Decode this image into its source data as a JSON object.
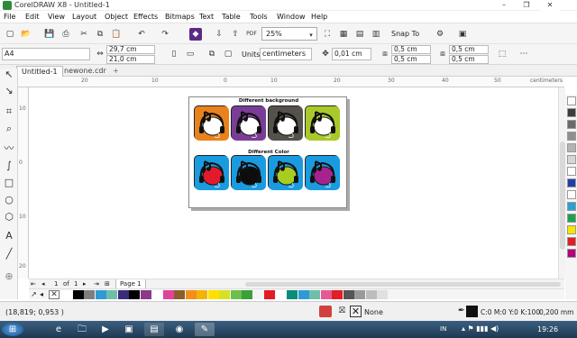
{
  "window": {
    "title": "CorelDRAW X8 - Untitled-1",
    "min": "–",
    "max": "❐",
    "close": "✕"
  },
  "menu": [
    "File",
    "Edit",
    "View",
    "Layout",
    "Object",
    "Effects",
    "Bitmaps",
    "Text",
    "Table",
    "Tools",
    "Window",
    "Help"
  ],
  "toolbar": {
    "zoom": "25%",
    "snap_to": "Snap To",
    "pdf_label": "PDF"
  },
  "properties": {
    "paper_size": "A4",
    "width": "29,7 cm",
    "height": "21,0 cm",
    "units_label": "Units:",
    "units": "centimeters",
    "nudge": "0,01 cm",
    "dup_x": "0,5 cm",
    "dup_y": "0,5 cm",
    "dup_x2": "0,5 cm",
    "dup_y2": "0,5 cm"
  },
  "tabs": {
    "active": "Untitled-1",
    "other": "newone.cdr",
    "add": "+"
  },
  "rulers": {
    "unit": "centimeters",
    "h_ticks": [
      "20",
      "10",
      "0",
      "10",
      "20",
      "30",
      "40",
      "50"
    ],
    "v_ticks": [
      "10",
      "0",
      "10",
      "20"
    ]
  },
  "page": {
    "section1": "Different background",
    "section2": "Different Color",
    "top_tiles": [
      {
        "bg": "#e8821c",
        "icon": "#ffffff"
      },
      {
        "bg": "#7a3d96",
        "icon": "#ffffff"
      },
      {
        "bg": "#55524b",
        "icon": "#ffffff"
      },
      {
        "bg": "#a9c92a",
        "icon": "#ffffff"
      }
    ],
    "bottom_tiles": [
      {
        "bg": "#1a9be0",
        "icon": "#e21b2c"
      },
      {
        "bg": "#1a9be0",
        "icon": "#0d0d0d"
      },
      {
        "bg": "#1a9be0",
        "icon": "#a8cd20"
      },
      {
        "bg": "#1a9be0",
        "icon": "#a6238f"
      }
    ]
  },
  "page_nav": {
    "current": "1",
    "of": "of",
    "total": "1",
    "tab": "Page 1"
  },
  "palette_h": [
    "#ffffff",
    "#000000",
    "#7e7e7e",
    "#2e9bd6",
    "#6fbfa8",
    "#3a2d7a",
    "#000000",
    "#8b3a8b",
    "#ffffff",
    "#e1439b",
    "#8b5e2b",
    "#f28f1c",
    "#f4b400",
    "#ffe000",
    "#d9e021",
    "#6cc04a",
    "#3aa13a",
    "#f4f4f4",
    "#e41c24",
    "#ffffff",
    "#0a8c7a",
    "#2e9bd6",
    "#6fbfa8",
    "#e55a94",
    "#e41c24",
    "#555555",
    "#9a9a9a",
    "#bdbdbd",
    "#e0e0e0"
  ],
  "palette_v": [
    "#ffffff",
    "#3d3d3d",
    "#6a6a6a",
    "#8f8f8f",
    "#b3b3b3",
    "#d6d6d6",
    "#ffffff",
    "#1f3fa8",
    "#ffffff",
    "#2aa0d8",
    "#1aa34a",
    "#f6e600",
    "#e41c24",
    "#b3007a"
  ],
  "status": {
    "coords": "(18,819; 0,953 )",
    "fill_none": "None",
    "fill_color": "C:0 M:0 Y:0 K:100",
    "outline": "0,200 mm"
  },
  "taskbar": {
    "lang": "IN",
    "time": "19:26"
  }
}
